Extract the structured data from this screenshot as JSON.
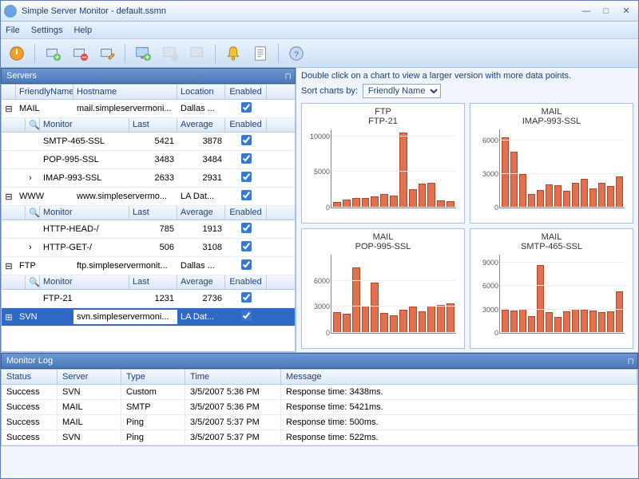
{
  "window": {
    "title": "Simple Server Monitor - default.ssmn"
  },
  "menu": {
    "file": "File",
    "settings": "Settings",
    "help": "Help"
  },
  "panels": {
    "servers": "Servers",
    "monitorLog": "Monitor Log"
  },
  "serverCols": {
    "friendly": "FriendlyName",
    "host": "Hostname",
    "loc": "Location",
    "enabled": "Enabled"
  },
  "monitorCols": {
    "monitor": "Monitor",
    "last": "Last",
    "avg": "Average",
    "enabled": "Enabled"
  },
  "servers": [
    {
      "expand": "⊟",
      "name": "MAIL",
      "host": "mail.simpleservermoni...",
      "loc": "Dallas ...",
      "enabled": true,
      "monitors": [
        {
          "sel": "",
          "name": "SMTP-465-SSL",
          "last": "5421",
          "avg": "3878",
          "enabled": true
        },
        {
          "sel": "",
          "name": "POP-995-SSL",
          "last": "3483",
          "avg": "3484",
          "enabled": true
        },
        {
          "sel": "›",
          "name": "IMAP-993-SSL",
          "last": "2633",
          "avg": "2931",
          "enabled": true
        }
      ]
    },
    {
      "expand": "⊟",
      "name": "WWW",
      "host": "www.simpleservermo...",
      "loc": "LA Dat...",
      "enabled": true,
      "monitors": [
        {
          "sel": "",
          "name": "HTTP-HEAD-/",
          "last": "785",
          "avg": "1913",
          "enabled": true
        },
        {
          "sel": "›",
          "name": "HTTP-GET-/",
          "last": "506",
          "avg": "3108",
          "enabled": true
        }
      ]
    },
    {
      "expand": "⊟",
      "name": "FTP",
      "host": "ftp.simpleservermonit...",
      "loc": "Dallas ...",
      "enabled": true,
      "monitors": [
        {
          "sel": "",
          "name": "FTP-21",
          "last": "1231",
          "avg": "2736",
          "enabled": true
        }
      ]
    },
    {
      "expand": "⊞",
      "name": "SVN",
      "host": "svn.simpleservermoni...",
      "loc": "LA Dat...",
      "enabled": true,
      "selected": true,
      "monitors": []
    }
  ],
  "hint": "Double click on a chart to view a larger version with more data points.",
  "sortLabel": "Sort charts by:",
  "sortOptions": [
    "Friendly Name"
  ],
  "sortValue": "Friendly Name",
  "logCols": {
    "status": "Status",
    "server": "Server",
    "type": "Type",
    "time": "Time",
    "msg": "Message"
  },
  "log": [
    {
      "status": "Success",
      "server": "SVN",
      "type": "Custom",
      "time": "3/5/2007 5:36 PM",
      "msg": "Response time: 3438ms."
    },
    {
      "status": "Success",
      "server": "MAIL",
      "type": "SMTP",
      "time": "3/5/2007 5:36 PM",
      "msg": "Response time: 5421ms."
    },
    {
      "status": "Success",
      "server": "MAIL",
      "type": "Ping",
      "time": "3/5/2007 5:37 PM",
      "msg": "Response time: 500ms."
    },
    {
      "status": "Success",
      "server": "SVN",
      "type": "Ping",
      "time": "3/5/2007 5:37 PM",
      "msg": "Response time: 522ms."
    }
  ],
  "chart_data": [
    {
      "type": "bar",
      "title": "FTP",
      "subtitle": "FTP-21",
      "ylim": [
        0,
        11000
      ],
      "yticks": [
        0,
        5000,
        10000
      ],
      "values": [
        800,
        1100,
        1400,
        1300,
        1600,
        1900,
        1700,
        10500,
        2600,
        3400,
        3500,
        1000,
        900
      ]
    },
    {
      "type": "bar",
      "title": "MAIL",
      "subtitle": "IMAP-993-SSL",
      "ylim": [
        0,
        7000
      ],
      "yticks": [
        0,
        3000,
        6000
      ],
      "values": [
        6300,
        5000,
        3000,
        1200,
        1600,
        2100,
        2000,
        1500,
        2200,
        2600,
        1700,
        2200,
        1900,
        2800
      ]
    },
    {
      "type": "bar",
      "title": "MAIL",
      "subtitle": "POP-995-SSL",
      "ylim": [
        0,
        9000
      ],
      "yticks": [
        0,
        3000,
        6000
      ],
      "values": [
        2400,
        2200,
        7500,
        3100,
        5800,
        2300,
        2000,
        2700,
        3000,
        2500,
        3100,
        3200,
        3400
      ]
    },
    {
      "type": "bar",
      "title": "MAIL",
      "subtitle": "SMTP-465-SSL",
      "ylim": [
        0,
        10000
      ],
      "yticks": [
        0,
        3000,
        6000,
        9000
      ],
      "values": [
        3000,
        2900,
        3100,
        2100,
        8700,
        2700,
        2000,
        2800,
        3100,
        3000,
        2900,
        2700,
        2800,
        5300
      ]
    }
  ]
}
